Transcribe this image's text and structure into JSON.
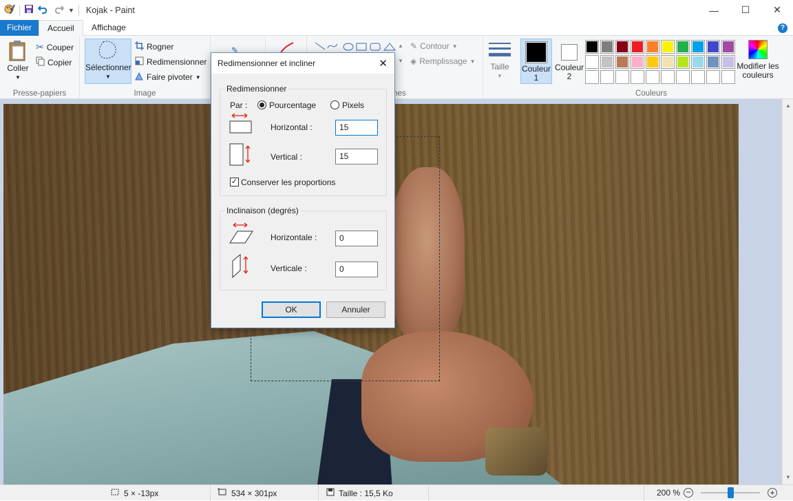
{
  "window": {
    "title": "Kojak - Paint"
  },
  "tabs": {
    "file": "Fichier",
    "home": "Accueil",
    "view": "Affichage"
  },
  "help_label": "?",
  "clipboard": {
    "paste": "Coller",
    "cut": "Couper",
    "copy": "Copier",
    "group": "Presse-papiers"
  },
  "image": {
    "select": "Sélectionner",
    "crop": "Rogner",
    "resize": "Redimensionner",
    "rotate": "Faire pivoter",
    "group": "Image"
  },
  "shapes": {
    "outline": "Contour",
    "fill": "Remplissage",
    "group_partial": "mes"
  },
  "size": {
    "label": "Taille"
  },
  "colors": {
    "color1": "Couleur 1",
    "color2": "Couleur 2",
    "edit": "Modifier les couleurs",
    "group": "Couleurs",
    "color1_value": "#000000",
    "color2_value": "#ffffff",
    "palette_row1": [
      "#000000",
      "#7f7f7f",
      "#880015",
      "#ed1c24",
      "#ff7f27",
      "#fff200",
      "#22b14c",
      "#00a2e8",
      "#3f48cc",
      "#a349a4"
    ],
    "palette_row2": [
      "#ffffff",
      "#c3c3c3",
      "#b97a57",
      "#ffaec9",
      "#ffc90e",
      "#efe4b0",
      "#b5e61d",
      "#99d9ea",
      "#7092be",
      "#c8bfe7"
    ]
  },
  "dialog": {
    "title": "Redimensionner et incliner",
    "resize_group": "Redimensionner",
    "by_label": "Par :",
    "percent": "Pourcentage",
    "pixels": "Pixels",
    "horizontal_label": "Horizontal :",
    "horizontal_value": "15",
    "vertical_label": "Vertical :",
    "vertical_value": "15",
    "keep_ratio": "Conserver les proportions",
    "skew_group": "Inclinaison (degrés)",
    "skew_h_label": "Horizontale :",
    "skew_h_value": "0",
    "skew_v_label": "Verticale :",
    "skew_v_value": "0",
    "ok": "OK",
    "cancel": "Annuler"
  },
  "status": {
    "selection": "5 × -13px",
    "image_size": "534 × 301px",
    "file_size": "Taille : 15,5 Ko",
    "zoom": "200 %",
    "zoom_fraction": 0.5
  }
}
